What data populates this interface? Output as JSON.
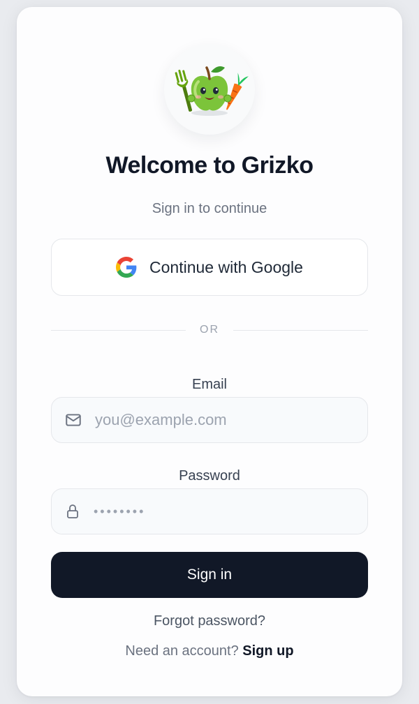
{
  "app": {
    "logo_icon": "apple-mascot-icon",
    "title": "Welcome to Grizko",
    "subtitle": "Sign in to continue"
  },
  "google": {
    "icon": "google-icon",
    "label": "Continue with Google"
  },
  "divider": {
    "label": "OR"
  },
  "email": {
    "label": "Email",
    "icon": "mail-icon",
    "value": "",
    "placeholder": "you@example.com"
  },
  "password": {
    "label": "Password",
    "icon": "lock-icon",
    "value": "",
    "placeholder": "••••••••"
  },
  "actions": {
    "sign_in_label": "Sign in",
    "forgot_label": "Forgot password?",
    "signup_prompt": "Need an account?",
    "signup_link": "Sign up"
  },
  "colors": {
    "primary_button": "#111827",
    "background": "#e9ebef",
    "card": "#fdfdfe"
  }
}
